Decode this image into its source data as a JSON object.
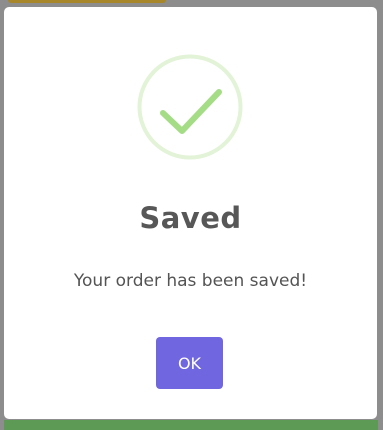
{
  "dialog": {
    "title": "Saved",
    "message": "Your order has been saved!",
    "confirm_label": "OK",
    "icon": "success-check-icon"
  },
  "colors": {
    "overlay": "#8d8d8d",
    "icon_ring": "#e2f3d7",
    "icon_check": "#a5dc86",
    "button": "#7066e0",
    "title_text": "#575757",
    "message_text": "#545454"
  }
}
